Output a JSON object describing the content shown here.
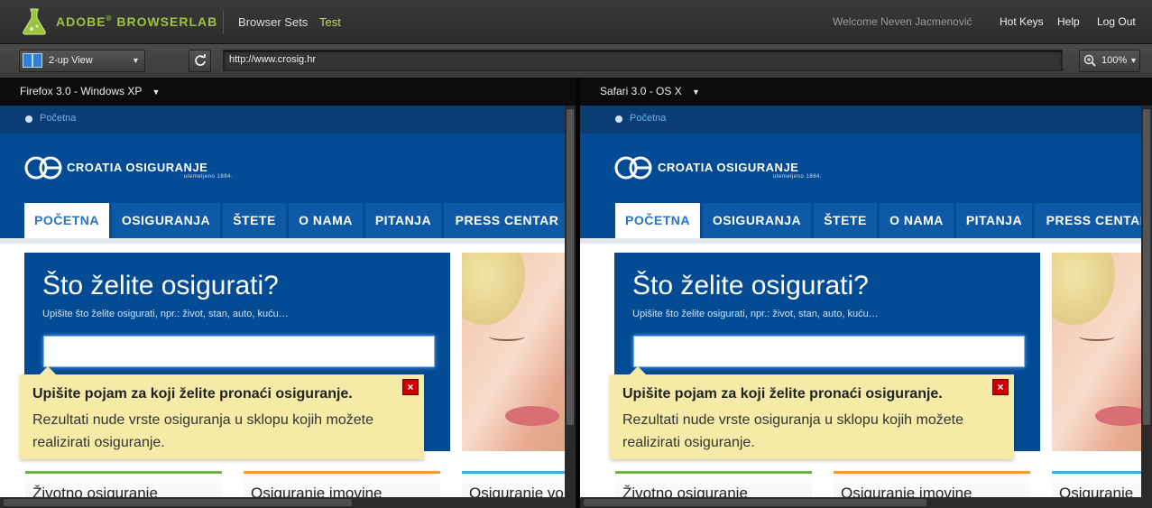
{
  "app": {
    "brand": "ADOBE",
    "brand_sup": "®",
    "brand_name": "BROWSERLAB",
    "nav_browser_sets": "Browser Sets",
    "nav_test": "Test",
    "welcome": "Welcome Neven Jacmenović",
    "hot_keys": "Hot Keys",
    "help": "Help",
    "log_out": "Log Out",
    "colors": {
      "brand": "#9bc43c",
      "active_nav": "#c8d84a"
    }
  },
  "toolbar": {
    "view_mode": "2-up View",
    "url": "http://www.crosig.hr",
    "zoom": "100%"
  },
  "panes": [
    {
      "browser": "Firefox 3.0 - Windows XP",
      "site": {
        "breadcrumb": "Početna",
        "logo_text": "CROATIA OSIGURANJE",
        "logo_sub": "utemeljeno 1884.",
        "menu": [
          "POČETNA",
          "OSIGURANJA",
          "ŠTETE",
          "O NAMA",
          "PITANJA",
          "PRESS CENTAR"
        ],
        "search_title": "Što želite osigurati?",
        "search_subtitle": "Upišite što želite osigurati, npr.: život, stan, auto, kuću…",
        "search_value": "",
        "tooltip_title": "Upišite pojam za koji želite pronaći osiguranje.",
        "tooltip_text": "Rezultati nude vrste osiguranja u sklopu kojih možete realizirati osiguranje.",
        "tooltip_close": "×",
        "cards": [
          "Životno osiguranje",
          "Osiguranje imovine",
          "Osiguranje vo"
        ]
      }
    },
    {
      "browser": "Safari 3.0 - OS X",
      "site": {
        "breadcrumb": "Početna",
        "logo_text": "CROATIA OSIGURANJE",
        "logo_sub": "utemeljeno 1884.",
        "menu": [
          "POČETNA",
          "OSIGURANJA",
          "ŠTETE",
          "O NAMA",
          "PITANJA",
          "PRESS CENTAR"
        ],
        "search_title": "Što želite osigurati?",
        "search_subtitle": "Upišite što želite osigurati, npr.: život, stan, auto, kuću…",
        "search_value": "",
        "tooltip_title": "Upišite pojam za koji želite pronaći osiguranje.",
        "tooltip_text": "Rezultati nude vrste osiguranja u sklopu kojih možete realizirati osiguranje.",
        "tooltip_close": "×",
        "cards": [
          "Životno osiguranje",
          "Osiguranje imovine",
          "Osiguranje"
        ]
      }
    }
  ],
  "site_colors": {
    "primary": "#034b94",
    "card_green": "#6cb33f",
    "card_orange": "#f29a2e",
    "card_blue": "#3fa9e6"
  }
}
